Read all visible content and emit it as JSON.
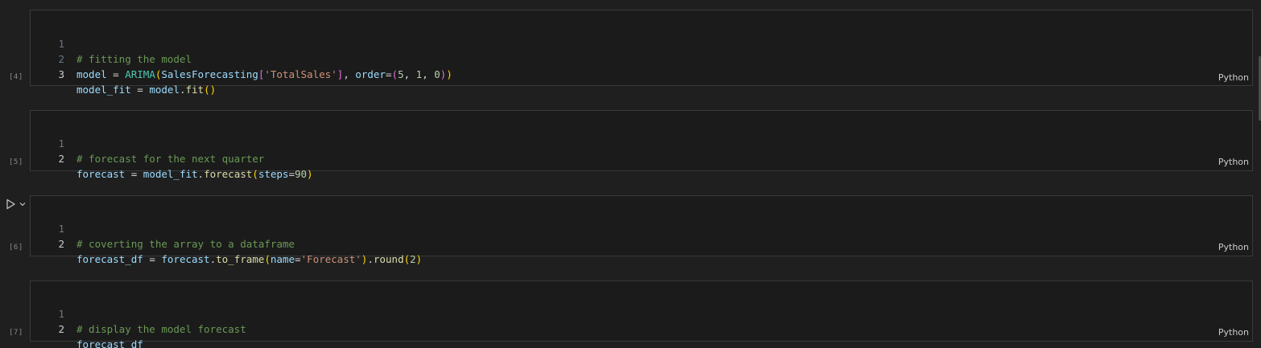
{
  "cells": [
    {
      "exec_count": "[4]",
      "language": "Python",
      "line_numbers": [
        "1",
        "2",
        "3"
      ],
      "lines": [
        [
          {
            "t": "# fitting the model",
            "c": "com"
          }
        ],
        [
          {
            "t": "model",
            "c": "var"
          },
          {
            "t": " = ",
            "c": "op"
          },
          {
            "t": "ARIMA",
            "c": "cls"
          },
          {
            "t": "(",
            "c": "br1"
          },
          {
            "t": "SalesForecasting",
            "c": "var"
          },
          {
            "t": "[",
            "c": "br2"
          },
          {
            "t": "'TotalSales'",
            "c": "str"
          },
          {
            "t": "]",
            "c": "br2"
          },
          {
            "t": ", ",
            "c": "op"
          },
          {
            "t": "order",
            "c": "var"
          },
          {
            "t": "=",
            "c": "op"
          },
          {
            "t": "(",
            "c": "br2"
          },
          {
            "t": "5",
            "c": "num"
          },
          {
            "t": ", ",
            "c": "op"
          },
          {
            "t": "1",
            "c": "num"
          },
          {
            "t": ", ",
            "c": "op"
          },
          {
            "t": "0",
            "c": "num"
          },
          {
            "t": ")",
            "c": "br2"
          },
          {
            "t": ")",
            "c": "br1"
          }
        ],
        [
          {
            "t": "model_fit",
            "c": "var"
          },
          {
            "t": " = ",
            "c": "op"
          },
          {
            "t": "model",
            "c": "var"
          },
          {
            "t": ".",
            "c": "op"
          },
          {
            "t": "fit",
            "c": "fn"
          },
          {
            "t": "()",
            "c": "br1"
          }
        ]
      ]
    },
    {
      "exec_count": "[5]",
      "language": "Python",
      "line_numbers": [
        "1",
        "2"
      ],
      "lines": [
        [
          {
            "t": "# forecast for the next quarter",
            "c": "com"
          }
        ],
        [
          {
            "t": "forecast",
            "c": "var"
          },
          {
            "t": " = ",
            "c": "op"
          },
          {
            "t": "model_fit",
            "c": "var"
          },
          {
            "t": ".",
            "c": "op"
          },
          {
            "t": "forecast",
            "c": "fn"
          },
          {
            "t": "(",
            "c": "br1"
          },
          {
            "t": "steps",
            "c": "var"
          },
          {
            "t": "=",
            "c": "op"
          },
          {
            "t": "90",
            "c": "num"
          },
          {
            "t": ")",
            "c": "br1"
          }
        ]
      ]
    },
    {
      "exec_count": "[6]",
      "language": "Python",
      "line_numbers": [
        "1",
        "2"
      ],
      "lines": [
        [
          {
            "t": "# coverting the array to a dataframe",
            "c": "com"
          }
        ],
        [
          {
            "t": "forecast_df",
            "c": "var"
          },
          {
            "t": " = ",
            "c": "op"
          },
          {
            "t": "forecast",
            "c": "var"
          },
          {
            "t": ".",
            "c": "op"
          },
          {
            "t": "to_frame",
            "c": "fn"
          },
          {
            "t": "(",
            "c": "br1"
          },
          {
            "t": "name",
            "c": "var"
          },
          {
            "t": "=",
            "c": "op"
          },
          {
            "t": "'Forecast'",
            "c": "str"
          },
          {
            "t": ")",
            "c": "br1"
          },
          {
            "t": ".",
            "c": "op"
          },
          {
            "t": "round",
            "c": "fn"
          },
          {
            "t": "(",
            "c": "br1"
          },
          {
            "t": "2",
            "c": "num"
          },
          {
            "t": ")",
            "c": "br1"
          }
        ]
      ]
    },
    {
      "exec_count": "[7]",
      "language": "Python",
      "line_numbers": [
        "1",
        "2"
      ],
      "lines": [
        [
          {
            "t": "# display the model forecast",
            "c": "com"
          }
        ],
        [
          {
            "t": "forecast_df",
            "c": "var"
          }
        ]
      ]
    }
  ],
  "run_button_icon": "play-icon",
  "run_menu_icon": "chevron-down-icon",
  "colors": {
    "background": "#1f1f1f",
    "cell_background": "#1b1b1b",
    "cell_border": "#3a3a3a",
    "comment": "#6a9955",
    "variable": "#9cdcfe",
    "class": "#4ec9b0",
    "function": "#dcdcaa",
    "string": "#ce9178",
    "number": "#b5cea8",
    "bracket_level1": "#ffd700",
    "bracket_level2": "#da70d6"
  }
}
